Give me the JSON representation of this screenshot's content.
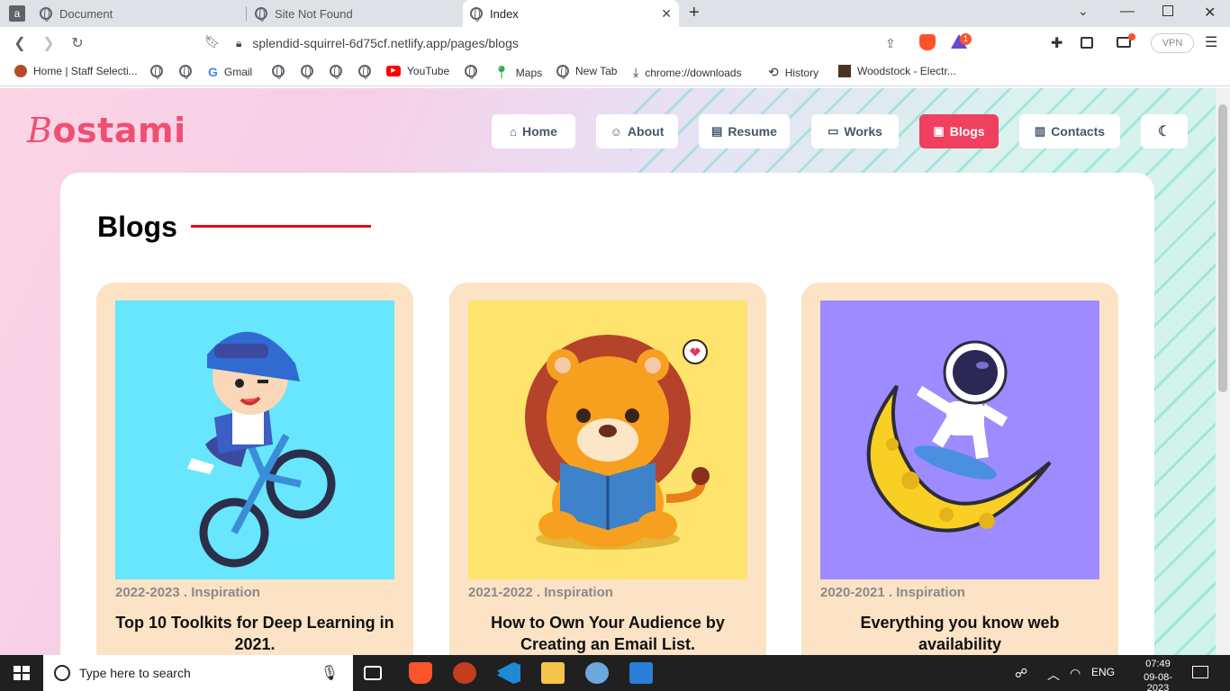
{
  "browser": {
    "tabs": [
      {
        "title": "Document",
        "active": false
      },
      {
        "title": "Site Not Found",
        "active": false
      },
      {
        "title": "Index",
        "active": true
      }
    ],
    "new_tab": "+",
    "url": "splendid-squirrel-6d75cf.netlify.app/pages/blogs",
    "vpn": "VPN",
    "brave_badge": "1",
    "bookmarks": [
      {
        "label": "Home | Staff Selecti...",
        "icon": "person-icon"
      },
      {
        "label": "",
        "icon": "globe-icon"
      },
      {
        "label": "",
        "icon": "globe-icon"
      },
      {
        "label": "Gmail",
        "icon": "google-icon"
      },
      {
        "label": "",
        "icon": "globe-icon"
      },
      {
        "label": "",
        "icon": "globe-icon"
      },
      {
        "label": "",
        "icon": "globe-icon"
      },
      {
        "label": "",
        "icon": "globe-icon"
      },
      {
        "label": "YouTube",
        "icon": "youtube-icon"
      },
      {
        "label": "",
        "icon": "globe-icon"
      },
      {
        "label": "Maps",
        "icon": "maps-pin-icon"
      },
      {
        "label": "New Tab",
        "icon": "globe-icon"
      },
      {
        "label": "chrome://downloads",
        "icon": "download-icon"
      },
      {
        "label": "History",
        "icon": "history-icon"
      },
      {
        "label": "Woodstock - Electr...",
        "icon": "thumbnail-icon"
      }
    ]
  },
  "site": {
    "logo_first": "B",
    "logo_rest": "ostami",
    "nav": [
      {
        "label": "Home",
        "icon": "house-icon",
        "active": false
      },
      {
        "label": "About",
        "icon": "user-icon",
        "active": false
      },
      {
        "label": "Resume",
        "icon": "file-icon",
        "active": false
      },
      {
        "label": "Works",
        "icon": "devices-icon",
        "active": false
      },
      {
        "label": "Blogs",
        "icon": "blog-icon",
        "active": true
      },
      {
        "label": "Contacts",
        "icon": "contact-card-icon",
        "active": false
      },
      {
        "label": "",
        "icon": "moon-icon",
        "active": false
      }
    ],
    "heading": "Blogs",
    "accent": "#ef4060",
    "posts": [
      {
        "meta": "2022-2023 . Inspiration",
        "title": "Top 10 Toolkits for Deep Learning in 2021.",
        "bg": "#67e6fd",
        "illustration": "boy-on-bike"
      },
      {
        "meta": "2021-2022 . Inspiration",
        "title": "How to Own Your Audience by Creating an Email List.",
        "bg": "#fee36c",
        "illustration": "lion-reading"
      },
      {
        "meta": "2020-2021 . Inspiration",
        "title": "Everything you know web availability",
        "bg": "#9e8bff",
        "illustration": "astronaut-on-moon"
      }
    ]
  },
  "taskbar": {
    "search_placeholder": "Type here to search",
    "lang": "ENG",
    "time": "07:49",
    "date": "09-08-2023"
  }
}
